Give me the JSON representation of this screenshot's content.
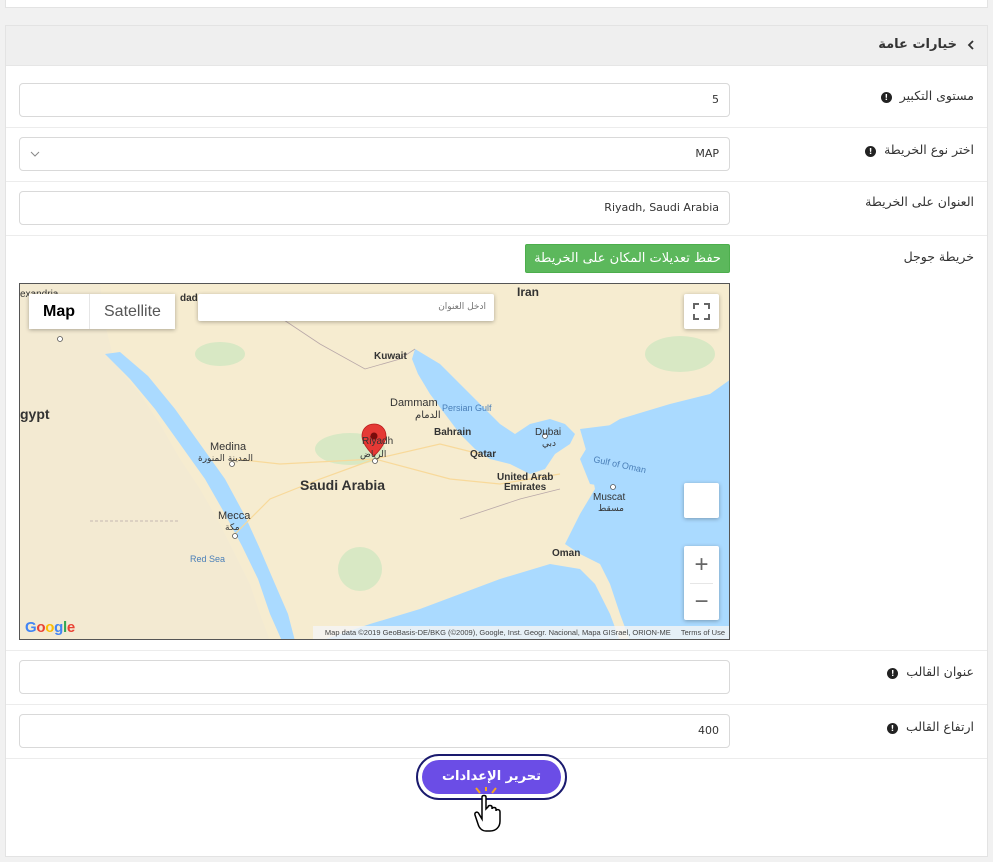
{
  "panel": {
    "title": "خيارات عامة"
  },
  "fields": {
    "zoom": {
      "label": "مستوى التكبير",
      "value": "5"
    },
    "map_type": {
      "label": "اختر نوع الخريطة",
      "value": "MAP"
    },
    "address": {
      "label": "العنوان على الخريطة",
      "value": "Riyadh, Saudi Arabia"
    },
    "google_map": {
      "label": "خريطة جوجل",
      "save_button": "حفظ تعديلات المكان على الخريطة"
    },
    "template_title": {
      "label": "عنوان القالب",
      "value": ""
    },
    "template_height": {
      "label": "ارتفاع القالب",
      "value": "400"
    }
  },
  "map": {
    "type_map": "Map",
    "type_satellite": "Satellite",
    "search_placeholder": "أدخل العنوان",
    "zoom_in": "+",
    "zoom_out": "−",
    "attribution": "Map data ©2019 GeoBasis-DE/BKG (©2009), Google, Inst. Geogr. Nacional, Mapa GISrael, ORION-ME",
    "terms": "Terms of Use",
    "labels": {
      "iran": "Iran",
      "kuwait": "Kuwait",
      "egypt": "gypt",
      "alexandria": "exandria",
      "dammam_en": "Dammam",
      "dammam_ar": "الدمام",
      "persian_gulf": "Persian Gulf",
      "bahrain": "Bahrain",
      "dubai_en": "Dubai",
      "dubai_ar": "دبي",
      "qatar": "Qatar",
      "uae_1": "United Arab",
      "uae_2": "Emirates",
      "gulf_of_oman": "Gulf of Oman",
      "muscat_en": "Muscat",
      "muscat_ar": "مسقط",
      "medina_en": "Medina",
      "medina_ar": "المدينة المنورة",
      "riyadh_en": "Riyadh",
      "riyadh_ar": "الرياض",
      "saudi": "Saudi Arabia",
      "mecca_en": "Mecca",
      "mecca_ar": "مكة",
      "red_sea": "Red Sea",
      "oman": "Oman",
      "dad": "dad",
      "google": "Google"
    }
  },
  "submit": {
    "label": "تحرير الإعدادات"
  },
  "colors": {
    "save_green": "#5cb85c",
    "submit_purple": "#6b4de6",
    "water": "#aadaff",
    "land": "#f6ecd0"
  }
}
